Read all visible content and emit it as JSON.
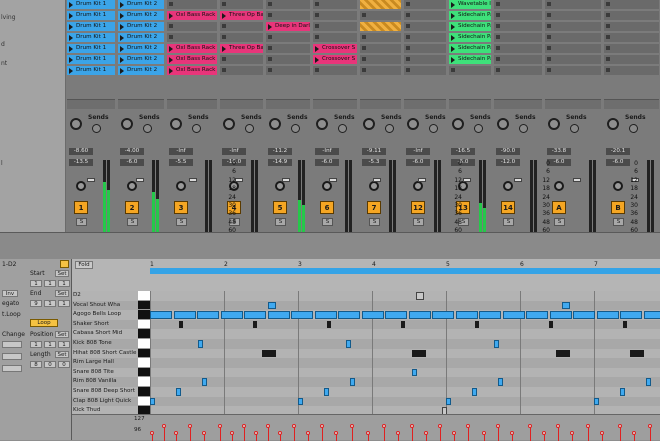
{
  "left_panel": {
    "labels": [
      "lving",
      "d",
      "nt",
      "l"
    ]
  },
  "session": {
    "tracks": [
      {
        "clips": [
          {
            "label": "Drum Kit 1",
            "color": "#3ba4e8"
          },
          {
            "label": "Drum Kit 1",
            "color": "#3ba4e8"
          },
          {
            "label": "Drum Kit 1",
            "color": "#3ba4e8"
          },
          {
            "label": "Drum Kit 1",
            "color": "#3ba4e8"
          },
          {
            "label": "Drum Kit 1",
            "color": "#3ba4e8"
          },
          {
            "label": "Drum Kit 1",
            "color": "#3ba4e8"
          },
          {
            "label": "Drum Kit 1",
            "color": "#3ba4e8"
          }
        ]
      },
      {
        "clips": [
          {
            "label": "Drum Kit 2",
            "color": "#3ba4e8"
          },
          {
            "label": "Drum Kit 2",
            "color": "#3ba4e8"
          },
          {
            "label": "Drum Kit 2",
            "color": "#3ba4e8"
          },
          {
            "label": "Drum Kit 2",
            "color": "#3ba4e8"
          },
          {
            "label": "Drum Kit 2",
            "color": "#3ba4e8"
          },
          {
            "label": "Drum Kit 2",
            "color": "#3ba4e8"
          },
          {
            "label": "Drum Kit 2",
            "color": "#3ba4e8"
          }
        ]
      }
    ],
    "clip_labels": {
      "oxl1": "Oxl Bass Rack",
      "oxl2": "Oxl Bass Rack",
      "oxl3": "Oxl Bass Rack",
      "oxl4": "Oxl Bass Rack",
      "three1": "Three Op Ba",
      "three2": "Three Op Ba",
      "deep": "Deep in Darl",
      "cross1": "Crossover S",
      "cross2": "Crossover S",
      "wave": "Wavetable I",
      "side1": "Sidechain Pad",
      "side2": "Sidechain Pad",
      "side3": "Sidechain Pad",
      "side4": "Sidechain Pad",
      "side5": "Sidechain Pad"
    },
    "io_numbers": {
      "t1": "6",
      "t1b": "32",
      "t2": "6",
      "t2b": "32",
      "t5": "32",
      "t10": "6",
      "t10b": "32"
    },
    "sends_label": "Sends",
    "knob_letters": [
      "A",
      "B"
    ],
    "volumes": [
      {
        "vol": "-8.60",
        "peak": "-13.5"
      },
      {
        "vol": "-4.00",
        "peak": "-6.0"
      },
      {
        "vol": "-Inf",
        "peak": "-5.5"
      },
      {
        "vol": "-Inf",
        "peak": "-16.0"
      },
      {
        "vol": "-11.2",
        "peak": "-14.9"
      },
      {
        "vol": "-Inf",
        "peak": "-6.0"
      },
      {
        "vol": "-9.11",
        "peak": "-5.3"
      },
      {
        "vol": "-Inf",
        "peak": "-6.0"
      },
      {
        "vol": "-16.5",
        "peak": "-6.0"
      },
      {
        "vol": "-90.0",
        "peak": "-12.0"
      },
      {
        "vol": "-33.8",
        "peak": "-6.0"
      },
      {
        "vol": "-20.1",
        "peak": "-6.0"
      }
    ],
    "db_scale": [
      "0",
      "6",
      "12",
      "18",
      "24",
      "30",
      "36",
      "48",
      "60"
    ],
    "track_numbers": [
      "1",
      "2",
      "3",
      "4",
      "5",
      "6",
      "7",
      "12",
      "13",
      "14",
      "A",
      "B"
    ],
    "solo": "S",
    "meter_levels": [
      0.7,
      0.55,
      0,
      0,
      0.45,
      0,
      0,
      0,
      0.4,
      0,
      0,
      0
    ]
  },
  "clip_view": {
    "clip_name": "1-D2",
    "start_label": "Start",
    "end_label": "End",
    "set_label": "Set",
    "start_vals": [
      "1",
      "1",
      "1"
    ],
    "end_vals": [
      "9",
      "1",
      "1"
    ],
    "legato": "egato",
    "inv": "Inv",
    "loop_label": "Loop",
    "loop_btn": "Loop",
    "position_label": "Position",
    "position_vals": [
      "1",
      "1",
      "1"
    ],
    "length_label": "Length",
    "length_vals": [
      "8",
      "0",
      "0"
    ],
    "change_label": "Change",
    "cut": "t.Loop"
  },
  "midi": {
    "fold": "Fold",
    "bars": [
      "1",
      "2",
      "3",
      "4",
      "5",
      "6",
      "7"
    ],
    "note_names": [
      "D2",
      "Vocal Shout Wha",
      "Agogo Bells Loop",
      "Shaker Short",
      "Cabasa Short Mid",
      "Kick 808 Tone",
      "Hihat 808 Short Castle",
      "Rim Large Hall",
      "Snare 808 Tite",
      "Rim 808 Vanilla",
      "Snare 808 Deep Short",
      "Clap 808 Light Quick",
      "Kick Thud"
    ],
    "velocity_labels": [
      "127",
      "96"
    ]
  },
  "colors": {
    "blue": "#3ba4e8",
    "pink": "#e8357a",
    "green": "#3ee07a",
    "orange": "#f5a623"
  }
}
